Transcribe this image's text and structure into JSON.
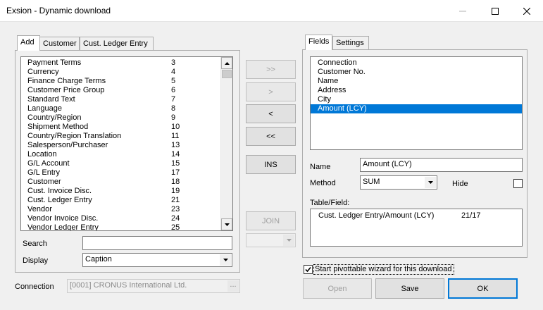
{
  "window": {
    "title": "Exsion - Dynamic download"
  },
  "left_tabs": [
    "Add",
    "Customer",
    "Cust. Ledger Entry"
  ],
  "table_list": [
    {
      "name": "Payment Terms",
      "id": "3"
    },
    {
      "name": "Currency",
      "id": "4"
    },
    {
      "name": "Finance Charge Terms",
      "id": "5"
    },
    {
      "name": "Customer Price Group",
      "id": "6"
    },
    {
      "name": "Standard Text",
      "id": "7"
    },
    {
      "name": "Language",
      "id": "8"
    },
    {
      "name": "Country/Region",
      "id": "9"
    },
    {
      "name": "Shipment Method",
      "id": "10"
    },
    {
      "name": "Country/Region Translation",
      "id": "11"
    },
    {
      "name": "Salesperson/Purchaser",
      "id": "13"
    },
    {
      "name": "Location",
      "id": "14"
    },
    {
      "name": "G/L Account",
      "id": "15"
    },
    {
      "name": "G/L Entry",
      "id": "17"
    },
    {
      "name": "Customer",
      "id": "18"
    },
    {
      "name": "Cust. Invoice Disc.",
      "id": "19"
    },
    {
      "name": "Cust. Ledger Entry",
      "id": "21"
    },
    {
      "name": "Vendor",
      "id": "23"
    },
    {
      "name": "Vendor Invoice Disc.",
      "id": "24"
    },
    {
      "name": "Vendor Ledger Entry",
      "id": "25"
    }
  ],
  "search": {
    "label": "Search",
    "value": ""
  },
  "display": {
    "label": "Display",
    "value": "Caption"
  },
  "connection": {
    "label": "Connection",
    "value": "[0001] CRONUS International Ltd.",
    "browse": "..."
  },
  "transfer": {
    "add_all": ">>",
    "add": ">",
    "remove": "<",
    "remove_all": "<<",
    "ins": "INS",
    "join": "JOIN",
    "join_value": ""
  },
  "right_tabs": [
    "Fields",
    "Settings"
  ],
  "fields_list": [
    "Connection",
    "Customer No.",
    "Name",
    "Address",
    "City",
    "Amount (LCY)"
  ],
  "selected_field_index": 5,
  "field_props": {
    "name_label": "Name",
    "name_value": "Amount (LCY)",
    "method_label": "Method",
    "method_value": "SUM",
    "hide_label": "Hide",
    "hide_checked": false,
    "table_field_label": "Table/Field:",
    "table_field_path": "Cust. Ledger Entry/Amount (LCY)",
    "table_field_ids": "21/17"
  },
  "pivot": {
    "label": "Start pivottable wizard for this download",
    "checked": true
  },
  "actions": {
    "open": "Open",
    "save": "Save",
    "ok": "OK"
  },
  "colors": {
    "selection": "#0078d7",
    "default_button": "#0078d7"
  }
}
